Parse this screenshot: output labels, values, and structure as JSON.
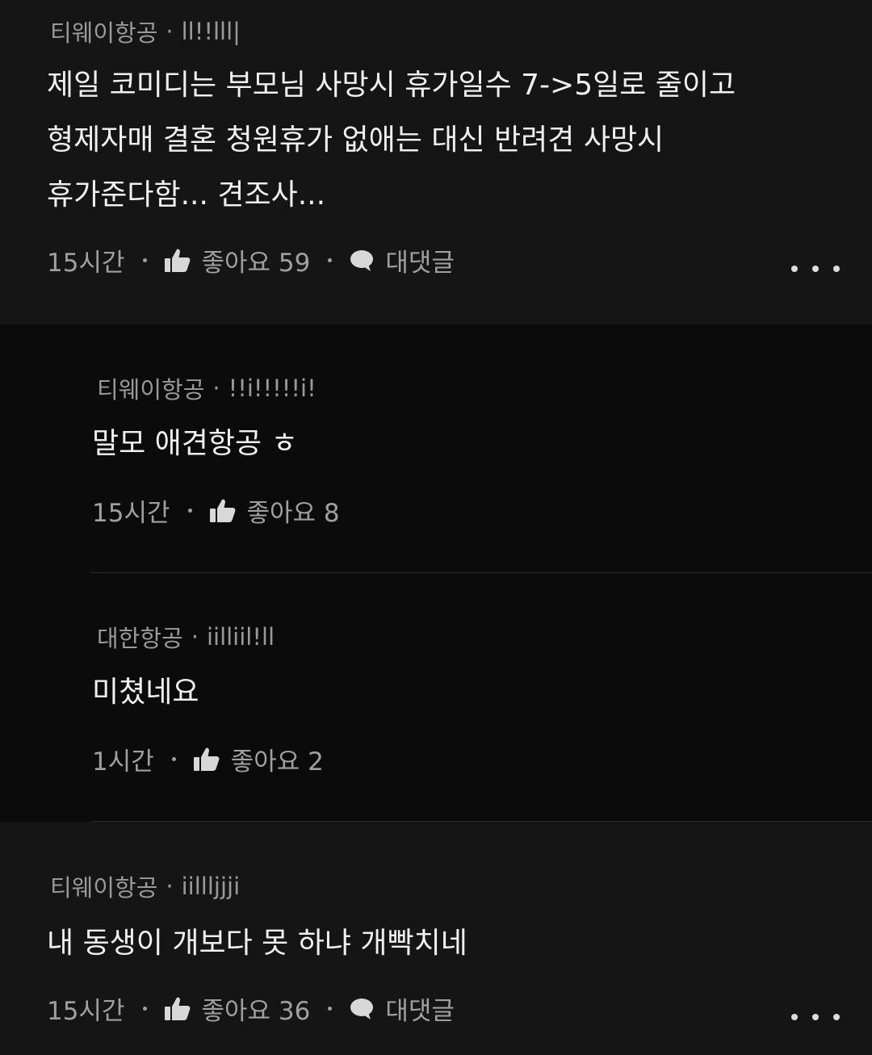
{
  "comments": [
    {
      "author": "티웨이항공",
      "handle": "ll!!lll|",
      "lines": [
        "제일 코미디는 부모님 사망시 휴가일수 7->5일로  줄이고",
        "형제자매 결혼 청원휴가 없애는 대신 반려견 사망시",
        "휴가준다함... 견조사..."
      ],
      "time": "15시간",
      "like_label": "좋아요 59",
      "reply_label": "대댓글"
    },
    {
      "author": "티웨이항공",
      "handle": "!!i!!!!!i!",
      "lines": [
        "말모 애견항공 ㅎ"
      ],
      "time": "15시간",
      "like_label": "좋아요 8"
    },
    {
      "author": "대한항공",
      "handle": "iilliil!ll",
      "lines": [
        "미쳤네요"
      ],
      "time": "1시간",
      "like_label": "좋아요 2"
    },
    {
      "author": "티웨이항공",
      "handle": "iillljjji",
      "lines": [
        "내 동생이 개보다 못 하냐 개빡치네"
      ],
      "time": "15시간",
      "like_label": "좋아요 36",
      "reply_label": "대댓글"
    }
  ],
  "separator": "·",
  "icons": {
    "like": "thumbs-up-icon",
    "reply": "speech-bubble-icon",
    "more": "more-options-icon"
  },
  "colors": {
    "background_top": "#151515",
    "background_replies": "#0b0b0b",
    "text_primary": "#f0f0f0",
    "text_secondary": "#9a9a9a"
  }
}
